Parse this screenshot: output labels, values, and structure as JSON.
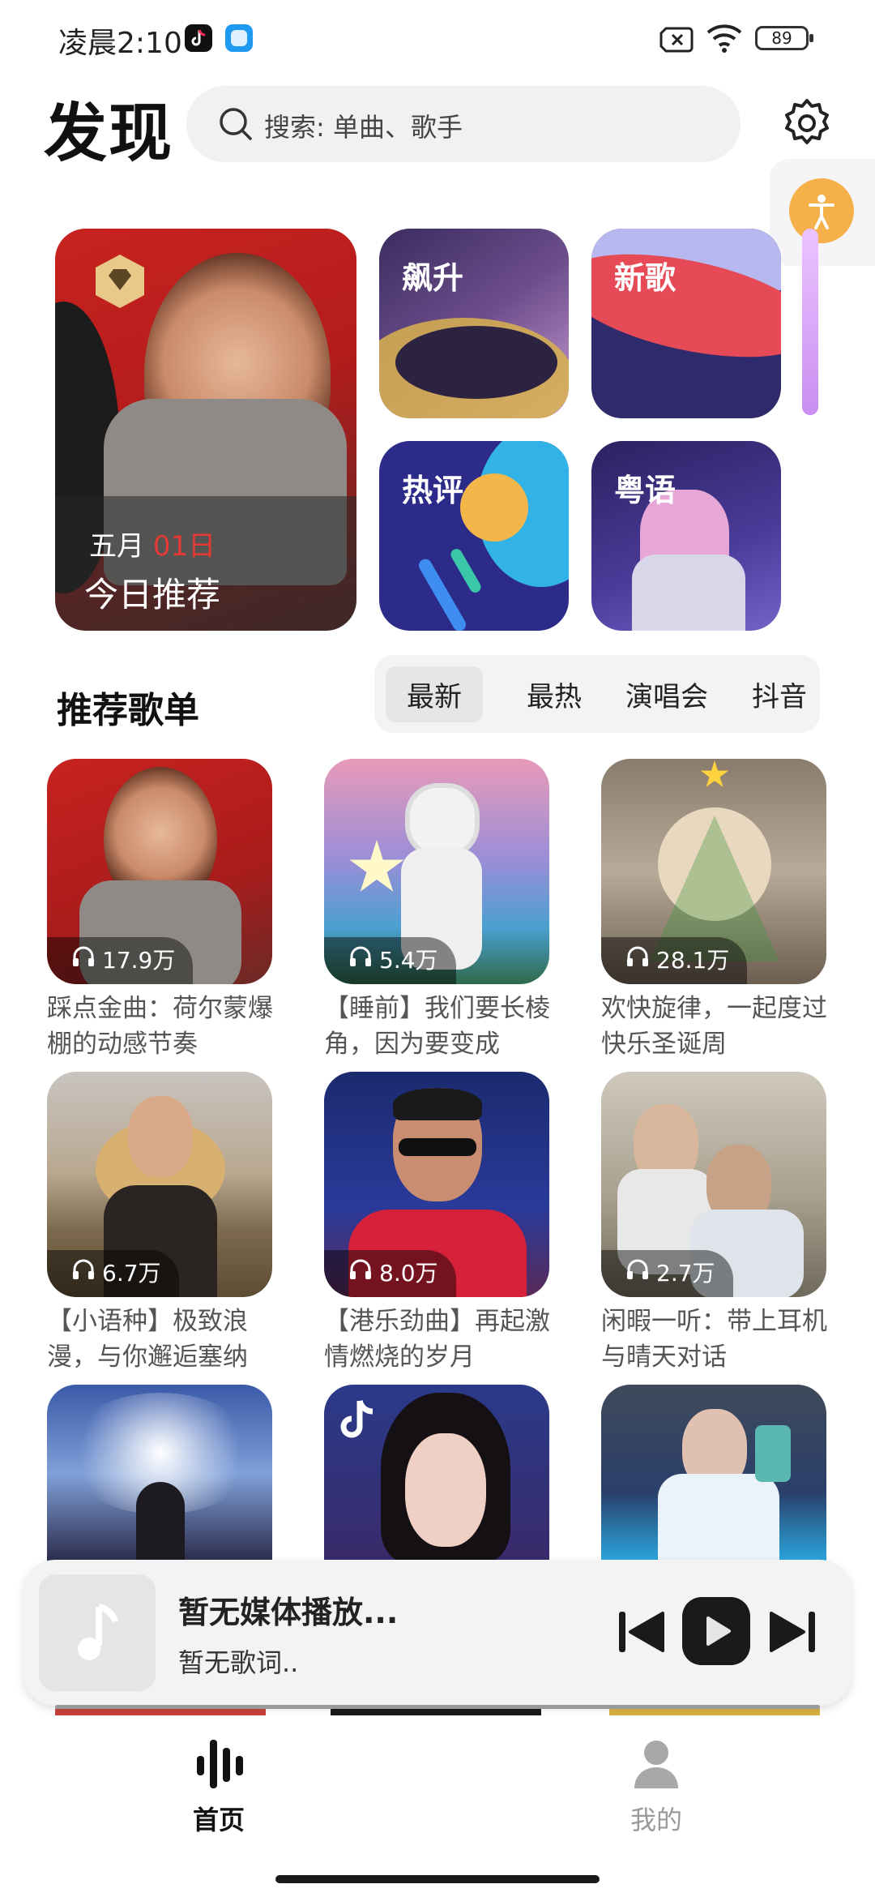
{
  "status_bar": {
    "time": "凌晨2:10",
    "battery": "89"
  },
  "header": {
    "title": "发现",
    "search_placeholder": "搜索: 单曲、歌手"
  },
  "featured": {
    "month": "五月",
    "day": "01日",
    "label": "今日推荐"
  },
  "tiles": [
    {
      "label": "飙升"
    },
    {
      "label": "新歌"
    },
    {
      "label": "热评"
    },
    {
      "label": "粤语"
    }
  ],
  "playlists_section": {
    "title": "推荐歌单",
    "tabs": [
      "最新",
      "最热",
      "演唱会",
      "抖音"
    ],
    "active_tab": "最新"
  },
  "playlists": [
    {
      "title": "踩点金曲：荷尔蒙爆棚的动感节奏",
      "plays": "17.9万"
    },
    {
      "title": "【睡前】我们要长棱角，因为要变成",
      "plays": "5.4万"
    },
    {
      "title": "欢快旋律，一起度过快乐圣诞周",
      "plays": "28.1万"
    },
    {
      "title": "【小语种】极致浪漫，与你邂逅塞纳",
      "plays": "6.7万"
    },
    {
      "title": "【港乐劲曲】再起激情燃烧的岁月",
      "plays": "8.0万"
    },
    {
      "title": "闲暇一听：带上耳机与晴天对话",
      "plays": "2.7万"
    }
  ],
  "player": {
    "title": "暂无媒体播放...",
    "subtitle": "暂无歌词.."
  },
  "bottom_nav": [
    {
      "label": "首页",
      "active": true
    },
    {
      "label": "我的",
      "active": false
    }
  ],
  "colors": {
    "accent_red": "#e53935",
    "nav_active": "#111111",
    "nav_inactive": "#9a9a9a",
    "accessibility_orange": "#f5b04a"
  }
}
